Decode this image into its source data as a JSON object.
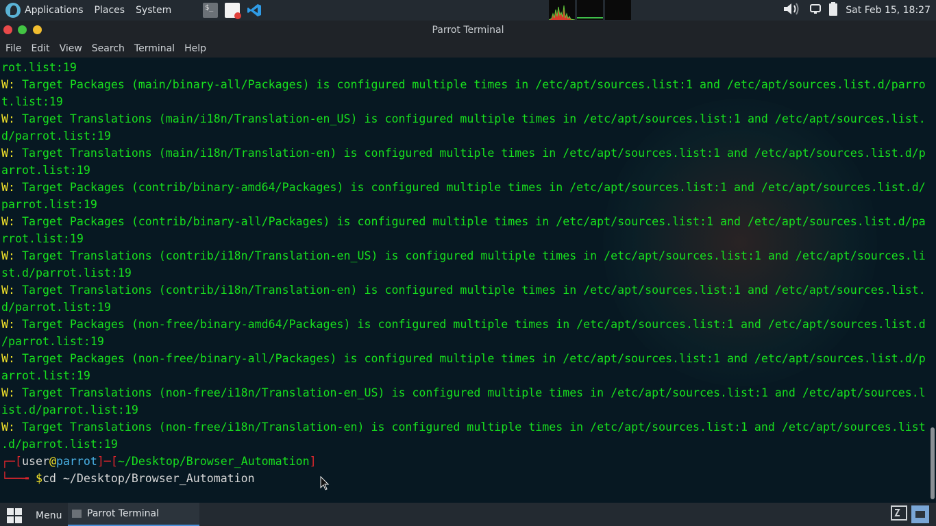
{
  "top_panel": {
    "applications_label": "Applications",
    "places_label": "Places",
    "system_label": "System",
    "clock": "Sat Feb 15, 18:27"
  },
  "window": {
    "title": "Parrot Terminal",
    "menu": [
      "File",
      "Edit",
      "View",
      "Search",
      "Terminal",
      "Help"
    ],
    "colors": {
      "close": "#e94a4a",
      "minimize": "#43c443",
      "maximize": "#f1bd2f",
      "text": "#18e01e",
      "warn": "#f5e52a"
    }
  },
  "terminal": {
    "lines": [
      {
        "prefix": "",
        "text": "rot.list:19"
      },
      {
        "prefix": "W:",
        "text": " Target Packages (main/binary-all/Packages) is configured multiple times in /etc/apt/sources.list:1 and /etc/apt/sources.list.d/parro"
      },
      {
        "prefix": "",
        "text": "t.list:19"
      },
      {
        "prefix": "W:",
        "text": " Target Translations (main/i18n/Translation-en_US) is configured multiple times in /etc/apt/sources.list:1 and /etc/apt/sources.list."
      },
      {
        "prefix": "",
        "text": "d/parrot.list:19"
      },
      {
        "prefix": "W:",
        "text": " Target Translations (main/i18n/Translation-en) is configured multiple times in /etc/apt/sources.list:1 and /etc/apt/sources.list.d/p"
      },
      {
        "prefix": "",
        "text": "arrot.list:19"
      },
      {
        "prefix": "W:",
        "text": " Target Packages (contrib/binary-amd64/Packages) is configured multiple times in /etc/apt/sources.list:1 and /etc/apt/sources.list.d/"
      },
      {
        "prefix": "",
        "text": "parrot.list:19"
      },
      {
        "prefix": "W:",
        "text": " Target Packages (contrib/binary-all/Packages) is configured multiple times in /etc/apt/sources.list:1 and /etc/apt/sources.list.d/pa"
      },
      {
        "prefix": "",
        "text": "rrot.list:19"
      },
      {
        "prefix": "W:",
        "text": " Target Translations (contrib/i18n/Translation-en_US) is configured multiple times in /etc/apt/sources.list:1 and /etc/apt/sources.li"
      },
      {
        "prefix": "",
        "text": "st.d/parrot.list:19"
      },
      {
        "prefix": "W:",
        "text": " Target Translations (contrib/i18n/Translation-en) is configured multiple times in /etc/apt/sources.list:1 and /etc/apt/sources.list."
      },
      {
        "prefix": "",
        "text": "d/parrot.list:19"
      },
      {
        "prefix": "W:",
        "text": " Target Packages (non-free/binary-amd64/Packages) is configured multiple times in /etc/apt/sources.list:1 and /etc/apt/sources.list.d"
      },
      {
        "prefix": "",
        "text": "/parrot.list:19"
      },
      {
        "prefix": "W:",
        "text": " Target Packages (non-free/binary-all/Packages) is configured multiple times in /etc/apt/sources.list:1 and /etc/apt/sources.list.d/p"
      },
      {
        "prefix": "",
        "text": "arrot.list:19"
      },
      {
        "prefix": "W:",
        "text": " Target Translations (non-free/i18n/Translation-en_US) is configured multiple times in /etc/apt/sources.list:1 and /etc/apt/sources.l"
      },
      {
        "prefix": "",
        "text": "ist.d/parrot.list:19"
      },
      {
        "prefix": "W:",
        "text": " Target Translations (non-free/i18n/Translation-en) is configured multiple times in /etc/apt/sources.list:1 and /etc/apt/sources.list"
      },
      {
        "prefix": "",
        "text": ".d/parrot.list:19"
      }
    ],
    "prompt": {
      "user": "user",
      "host": "parrot",
      "path": "~/Desktop/Browser_Automation",
      "symbol": "$",
      "command": "cd ~/Desktop/Browser_Automation"
    }
  },
  "bottom_panel": {
    "menu_label": "Menu",
    "task_label": "Parrot Terminal"
  }
}
